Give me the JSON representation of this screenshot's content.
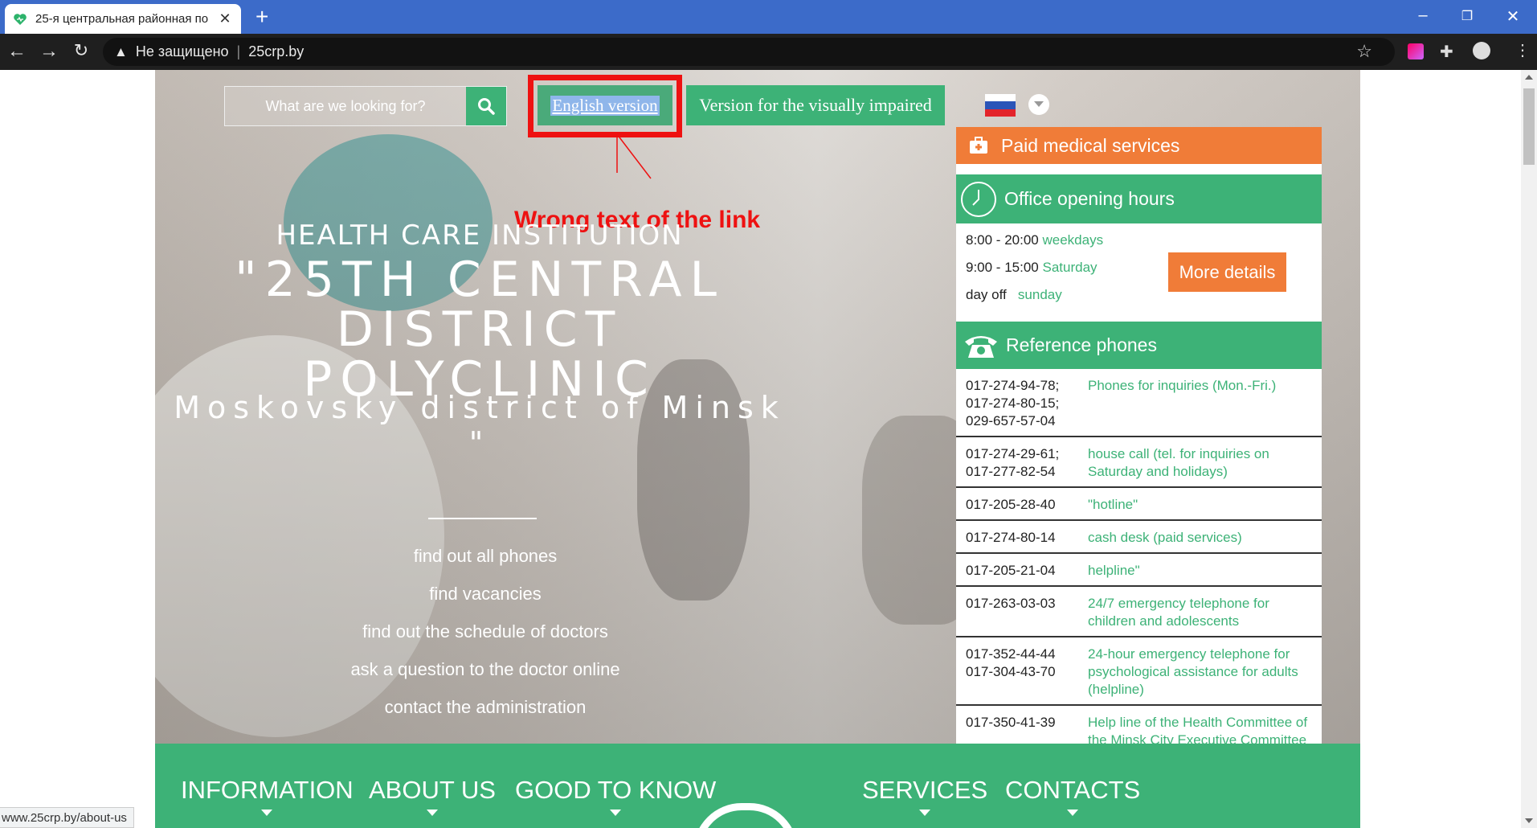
{
  "browser": {
    "tab_title": "25-я центральная районная по...",
    "not_secure": "Не защищено",
    "url": "25crp.by",
    "new_tab": "+",
    "close_tab": "✕",
    "status_url": "www.25crp.by/about-us"
  },
  "colors": {
    "accent_green": "#3db277",
    "accent_orange": "#f07c38",
    "annotation_red": "#ee1111"
  },
  "header": {
    "search_placeholder": "What are we looking for?",
    "english_version": "English version",
    "visually_impaired": "Version for the visually impaired",
    "language_flag": "russian-flag-icon"
  },
  "annotation": {
    "text": "Wrong text of the link"
  },
  "hero": {
    "institution": "HEALTH CARE INSTITUTION",
    "name_line1": "\"25TH CENTRAL",
    "name_line2": "DISTRICT",
    "name_line3": "POLYCLINIC",
    "district": "Moskovsky district of Minsk \"",
    "links": [
      "find out all phones",
      "find vacancies",
      "find out the schedule of doctors",
      "ask a question to the doctor online",
      "contact the administration"
    ]
  },
  "sidebar": {
    "paid": "Paid medical services",
    "hours_title": "Office opening hours",
    "hours": [
      {
        "time": "8:00 - 20:00",
        "day": "weekdays"
      },
      {
        "time": "9:00 - 15:00",
        "day": "Saturday"
      },
      {
        "time": "day off",
        "day": "sunday"
      }
    ],
    "more_details": "More details",
    "phones_title": "Reference phones",
    "phones": [
      {
        "num": "017-274-94-78;\n017-274-80-15;\n029-657-57-04",
        "desc": "Phones for inquiries (Mon.-Fri.)"
      },
      {
        "num": "017-274-29-61;\n017-277-82-54",
        "desc": "house call (tel. for inquiries on Saturday and holidays)"
      },
      {
        "num": "017-205-28-40",
        "desc": "\"hotline\""
      },
      {
        "num": "017-274-80-14",
        "desc": "cash desk (paid services)"
      },
      {
        "num": "017-205-21-04",
        "desc": "helpline\""
      },
      {
        "num": "017-263-03-03",
        "desc": "24/7 emergency telephone for children and adolescents"
      },
      {
        "num": "017-352-44-44\n017-304-43-70",
        "desc": "24-hour emergency telephone for psychological assistance for adults (helpline)"
      },
      {
        "num": "017-350-41-39",
        "desc": "Help line of the Health Committee of the Minsk City Executive Committee"
      }
    ]
  },
  "menu": {
    "items": [
      "INFORMATION",
      "ABOUT US",
      "GOOD TO KNOW",
      "SERVICES",
      "CONTACTS"
    ]
  }
}
